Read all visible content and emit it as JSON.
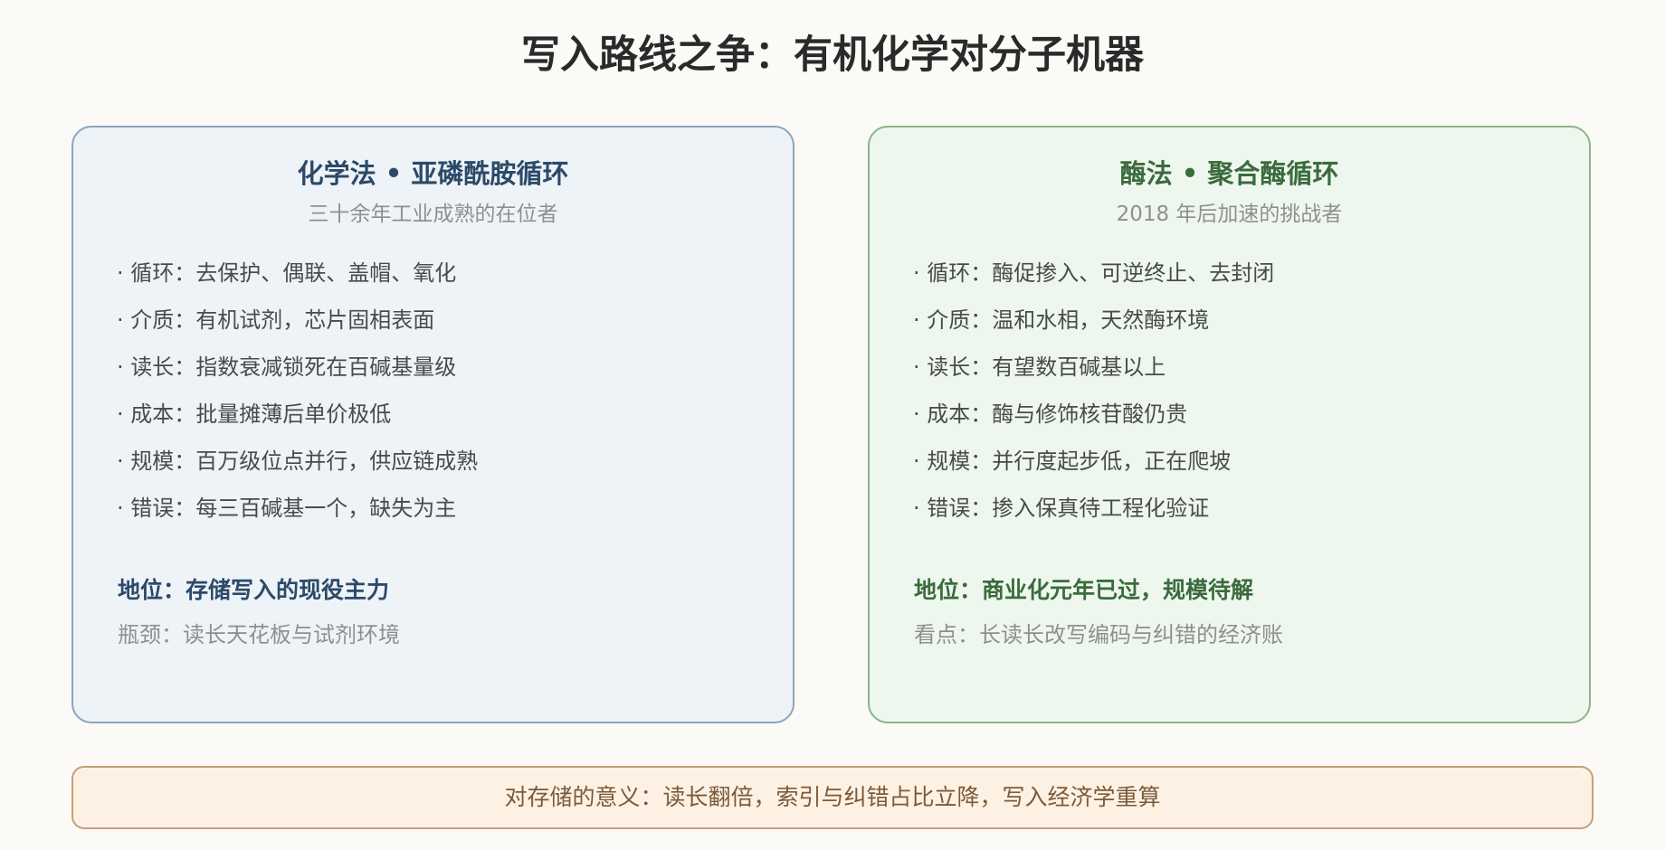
{
  "title": "写入路线之争：有机化学对分子机器",
  "left_card": {
    "title": "化学法 • 亚磷酰胺循环",
    "subtitle": "三十余年工业成熟的在位者",
    "items": [
      "· 循环：去保护、偶联、盖帽、氧化",
      "· 介质：有机试剂，芯片固相表面",
      "· 读长：指数衰减锁死在百碱基量级",
      "· 成本：批量摊薄后单价极低",
      "· 规模：百万级位点并行，供应链成熟",
      "· 错误：每三百碱基一个，缺失为主"
    ],
    "status": "地位：存储写入的现役主力",
    "note": "瓶颈：读长天花板与试剂环境",
    "colors": {
      "background": "#eef3f8",
      "border": "#8ba5c2",
      "accent": "#2c4a68"
    }
  },
  "right_card": {
    "title": "酶法 • 聚合酶循环",
    "subtitle": "2018 年后加速的挑战者",
    "items": [
      "· 循环：酶促掺入、可逆终止、去封闭",
      "· 介质：温和水相，天然酶环境",
      "· 读长：有望数百碱基以上",
      "· 成本：酶与修饰核苷酸仍贵",
      "· 规模：并行度起步低，正在爬坡",
      "· 错误：掺入保真待工程化验证"
    ],
    "status": "地位：商业化元年已过，规模待解",
    "note": "看点：长读长改写编码与纠错的经济账",
    "colors": {
      "background": "#eef7ee",
      "border": "#8ab48c",
      "accent": "#3b6b3d"
    }
  },
  "footer": {
    "text": "对存储的意义：读长翻倍，索引与纠错占比立降，写入经济学重算",
    "colors": {
      "background": "#fdf1e4",
      "border": "#c4a07a",
      "text": "#7d5a38"
    }
  }
}
